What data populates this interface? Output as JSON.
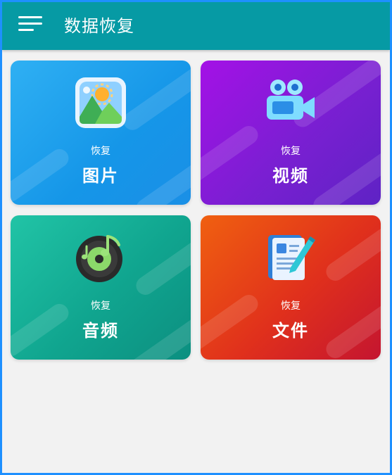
{
  "header": {
    "title": "数据恢复"
  },
  "cards": [
    {
      "sub": "恢复",
      "label": "图片"
    },
    {
      "sub": "恢复",
      "label": "视频"
    },
    {
      "sub": "恢复",
      "label": "音频"
    },
    {
      "sub": "恢复",
      "label": "文件"
    }
  ],
  "colors": {
    "appbar": "#069aa4",
    "photos": "#1596e8",
    "videos": "#7a1fd2",
    "audio": "#10a58f",
    "files": "#e0301c",
    "background": "#f2f2f2"
  }
}
